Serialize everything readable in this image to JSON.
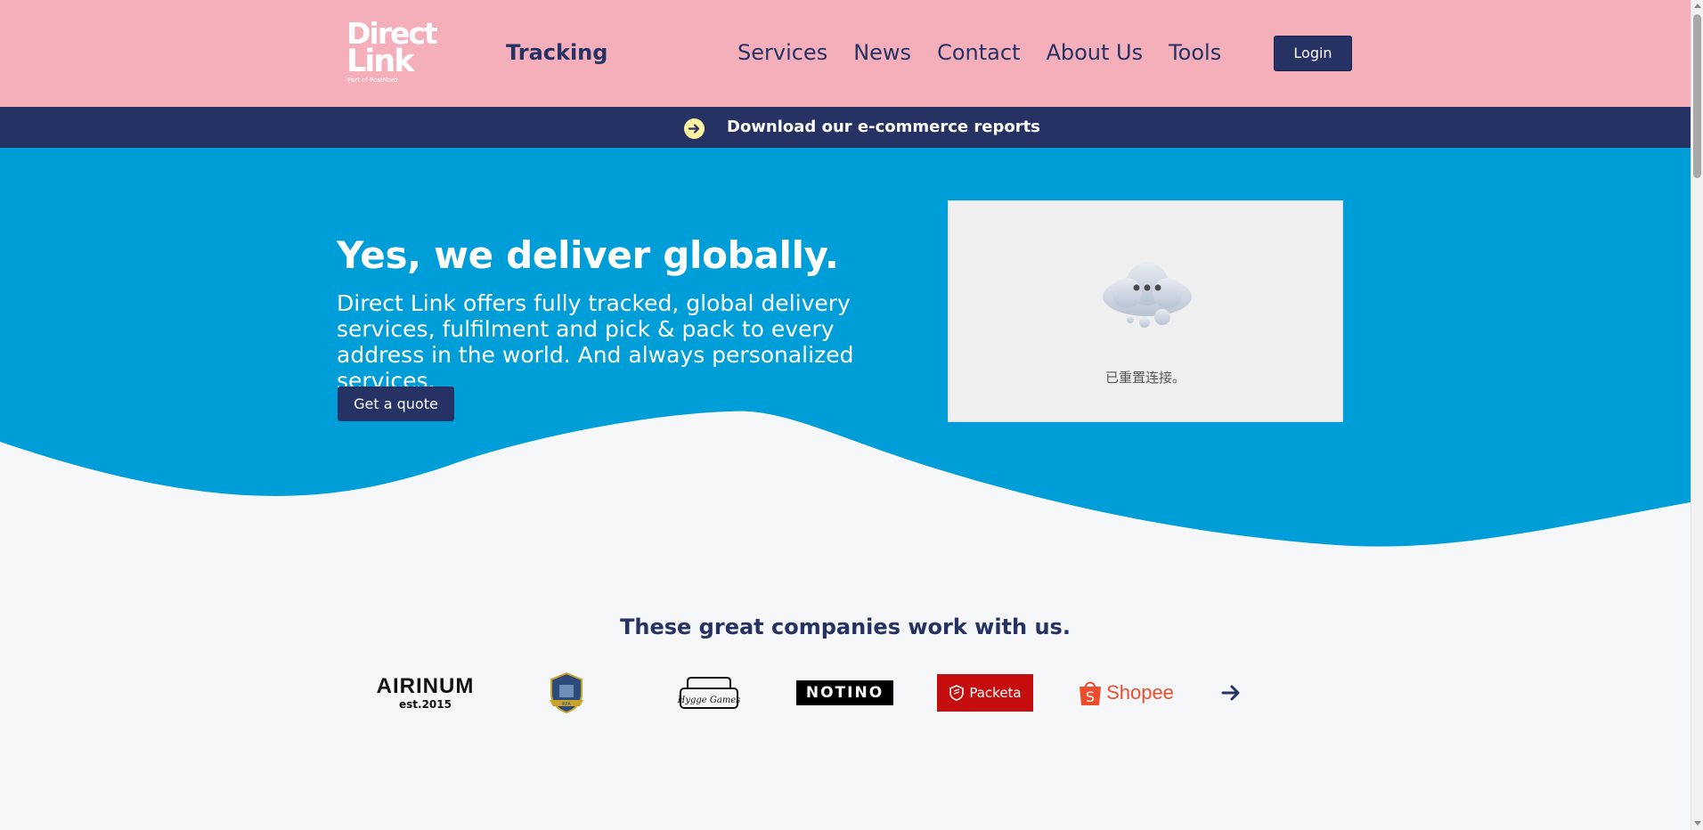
{
  "header": {
    "logo_line1": "Direct",
    "logo_line2": "Link",
    "logo_tagline": "Part of PostNord",
    "tracking_label": "Tracking",
    "nav": [
      "Services",
      "News",
      "Contact",
      "About Us",
      "Tools"
    ],
    "login_label": "Login"
  },
  "banner": {
    "text": "Download our e-commerce reports",
    "icon": "arrow-right-circle-icon"
  },
  "hero": {
    "title": "Yes, we deliver globally.",
    "description": "Direct Link offers fully tracked, global delivery services, fulfilment and pick & pack to every address in the world. And always personalized services.",
    "cta_label": "Get a quote",
    "video_message": "已重置连接。"
  },
  "companies": {
    "title": "These great companies work with us.",
    "logos": {
      "airinum_name": "AIRINUM",
      "airinum_est": "est.2015",
      "shield_text": "RPA",
      "hygge_text": "Hygge Games",
      "notino": "NOTINO",
      "packeta": "Packeta",
      "shopee": "Shopee"
    }
  },
  "colors": {
    "header_bg": "#f4afbb",
    "navy": "#263263",
    "hero_blue": "#009ed8",
    "page_bg": "#f5f7f9",
    "banner_icon": "#fff39f"
  }
}
